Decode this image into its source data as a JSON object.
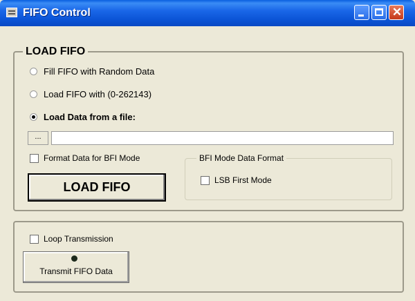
{
  "window": {
    "title": "FIFO Control"
  },
  "load_group": {
    "legend": "LOAD FIFO",
    "option_random": "Fill FIFO with Random Data",
    "option_range": "Load FIFO with (0-262143)",
    "option_file": "Load Data from a file:",
    "browse_label": "...",
    "file_path": "",
    "format_bfi_label": "Format Data for BFI Mode",
    "load_button": "LOAD FIFO",
    "bfi_group": {
      "legend": "BFI Mode Data Format",
      "lsb_first_label": "LSB First Mode"
    }
  },
  "transmit_group": {
    "loop_label": "Loop Transmission",
    "transmit_button": "Transmit FIFO Data"
  }
}
